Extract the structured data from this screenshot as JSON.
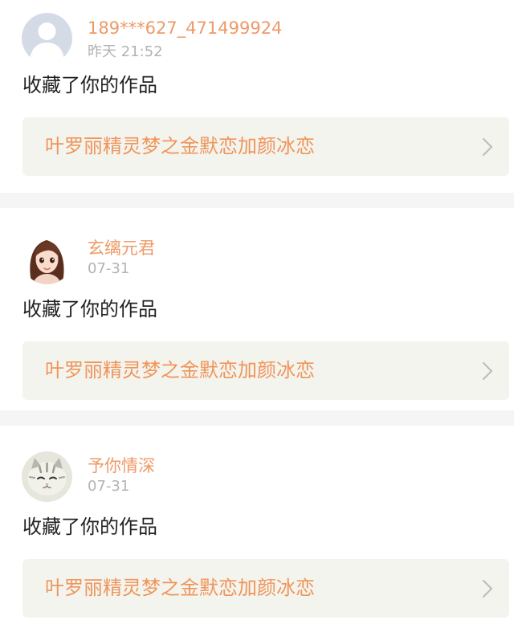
{
  "feed": {
    "items": [
      {
        "username": "189***627_471499924",
        "timestamp": "昨天 21:52",
        "action": "收藏了你的作品",
        "work_title": "叶罗丽精灵梦之金默恋加颜冰恋",
        "avatar": "default-user-avatar"
      },
      {
        "username": "玄缡元君",
        "timestamp": "07-31",
        "action": "收藏了你的作品",
        "work_title": "叶罗丽精灵梦之金默恋加颜冰恋",
        "avatar": "anime-girl-avatar"
      },
      {
        "username": "予你情深",
        "timestamp": "07-31",
        "action": "收藏了你的作品",
        "work_title": "叶罗丽精灵梦之金默恋加颜冰恋",
        "avatar": "cat-avatar"
      }
    ]
  },
  "colors": {
    "username": "#ee9a67",
    "work_title": "#ef9559",
    "timestamp": "#b3b3b3",
    "link_background": "#f4f4ef",
    "separator": "#f5f5f5"
  },
  "icons": {
    "chevron": "chevron-right-icon"
  }
}
